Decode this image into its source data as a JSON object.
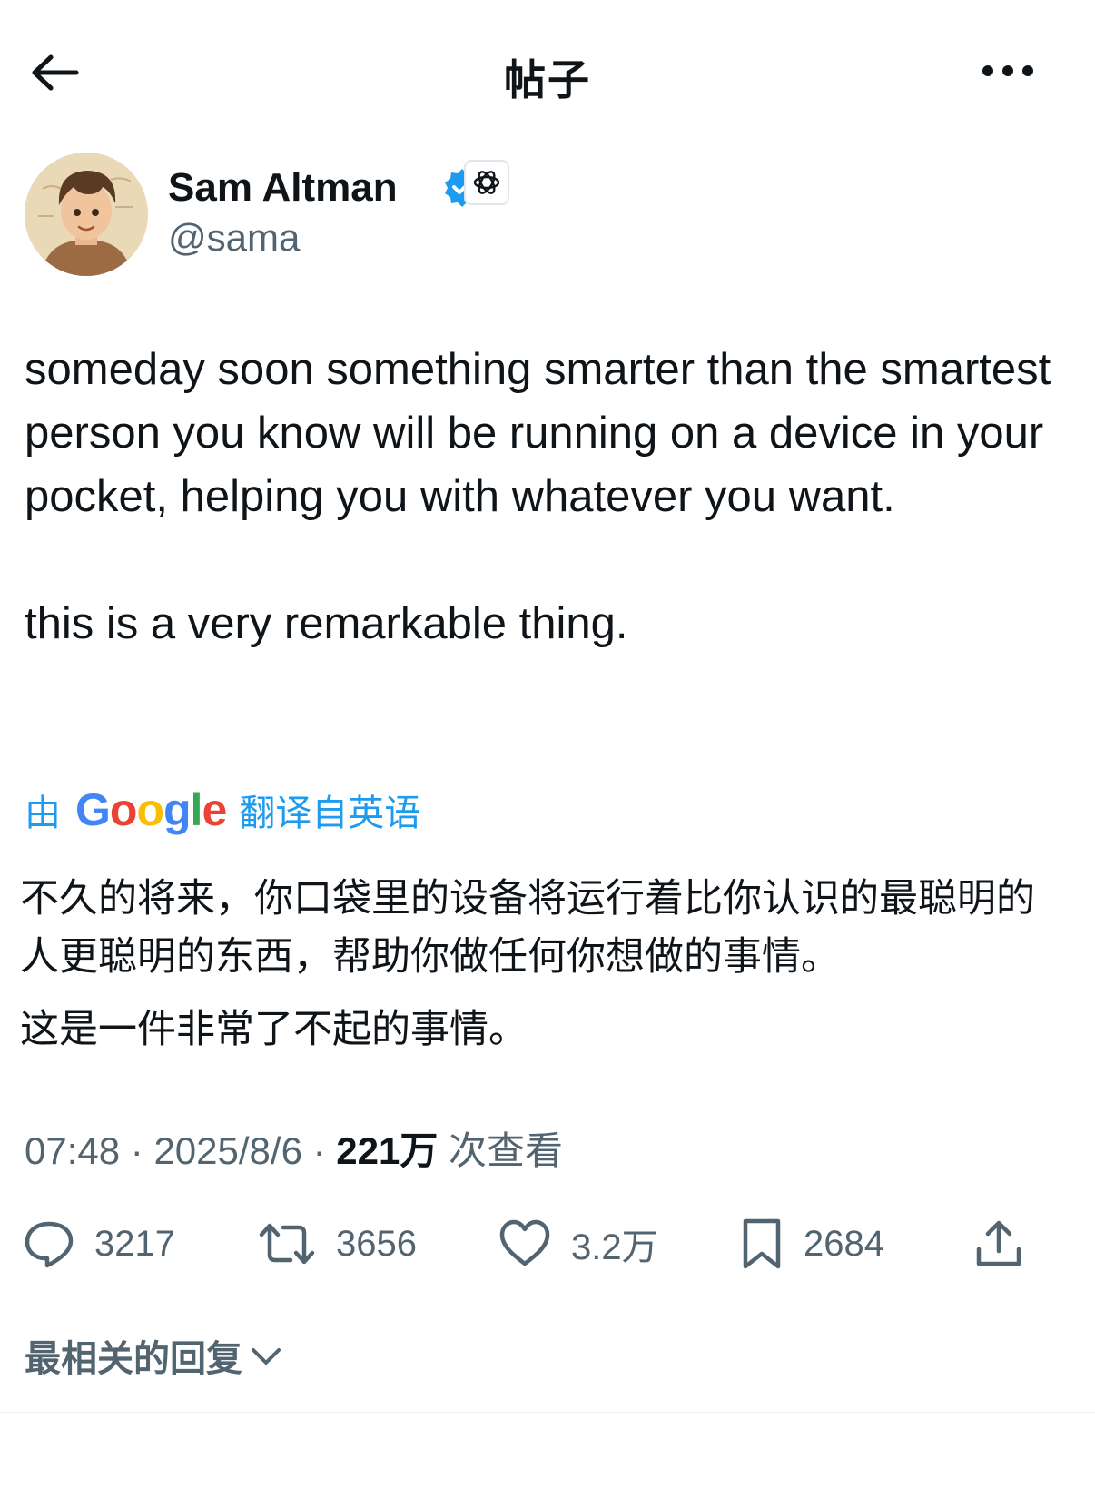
{
  "header": {
    "title": "帖子",
    "back_icon": "arrow-left-icon",
    "more_icon": "more-horizontal-icon"
  },
  "author": {
    "name": "Sam Altman",
    "handle": "@sama",
    "verified": true,
    "verified_color": "#1d9bf0",
    "affiliation_icon": "openai-logo-icon"
  },
  "post": {
    "paragraphs": [
      "someday soon something smarter than the smartest person you know will be running on a device in your pocket, helping you with whatever you want.",
      "this is a very remarkable thing."
    ]
  },
  "translation": {
    "prefix": "由",
    "provider": "Google",
    "suffix": "翻译自英语",
    "paragraphs": [
      "不久的将来，你口袋里的设备将运行着比你认识的最聪明的人更聪明的东西，帮助你做任何你想做的事情。",
      "这是一件非常了不起的事情。"
    ],
    "link_color": "#1d9bf0"
  },
  "meta": {
    "time": "07:48",
    "separator": "·",
    "date": "2025/8/6",
    "views_count": "221万",
    "views_label": "次查看"
  },
  "actions": {
    "replies": "3217",
    "reposts": "3656",
    "likes": "3.2万",
    "bookmarks": "2684"
  },
  "replies_sort": {
    "label": "最相关的回复"
  },
  "colors": {
    "text": "#0f1419",
    "secondary": "#536471",
    "accent": "#1d9bf0"
  }
}
